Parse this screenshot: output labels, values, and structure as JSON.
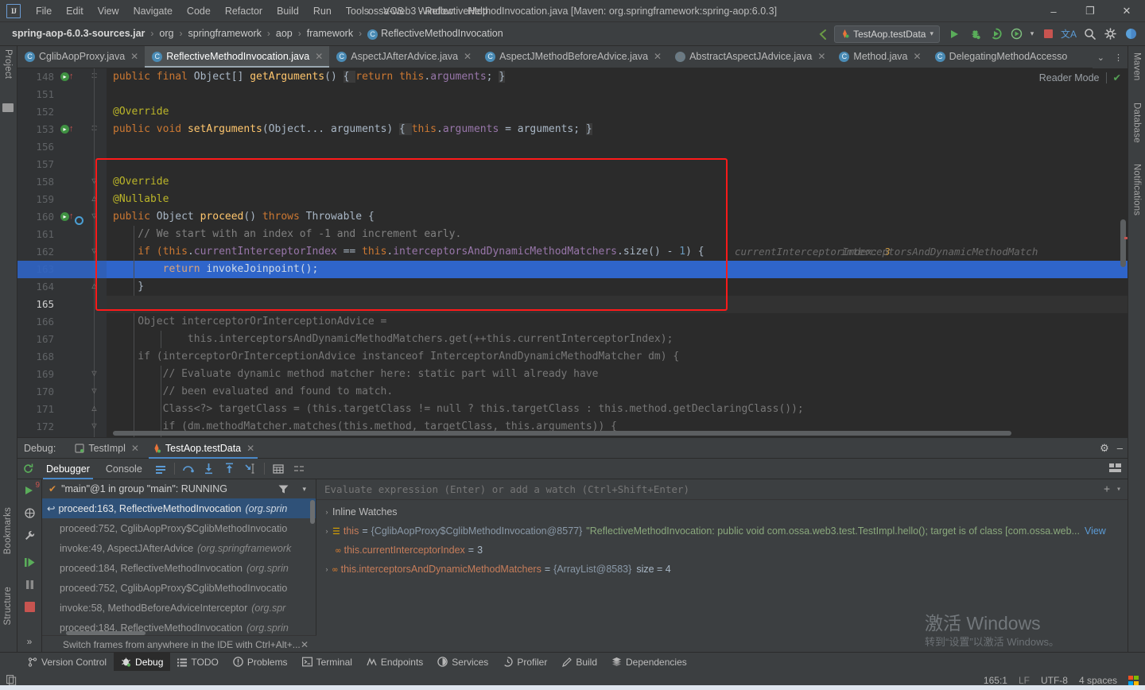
{
  "window": {
    "title": "ossa-web3 - ReflectiveMethodInvocation.java [Maven: org.springframework:spring-aop:6.0.3]",
    "logo": "IJ",
    "minimize": "–",
    "maximize": "❐",
    "close": "✕"
  },
  "menu": {
    "items": [
      "File",
      "Edit",
      "View",
      "Navigate",
      "Code",
      "Refactor",
      "Build",
      "Run",
      "Tools",
      "VCS",
      "Window",
      "Help"
    ]
  },
  "breadcrumbs": {
    "items": [
      {
        "label": "spring-aop-6.0.3-sources.jar",
        "icon": ""
      },
      {
        "label": "org",
        "icon": ""
      },
      {
        "label": "springframework",
        "icon": ""
      },
      {
        "label": "aop",
        "icon": ""
      },
      {
        "label": "framework",
        "icon": ""
      },
      {
        "label": "ReflectiveMethodInvocation",
        "icon": "C"
      }
    ],
    "separator": "›"
  },
  "nav_actions": {
    "back_arrow": "back-arrow-icon",
    "run_config": "TestAop.testData",
    "run_config_chevron": "▾",
    "run": "▶",
    "debug": "debug-icon",
    "coverage": "coverage-icon",
    "profile": "profile-icon",
    "profile_chevron": "▾",
    "stop": "stop-icon",
    "translate": "文A",
    "search": "⌕",
    "settings": "⚙",
    "account": "account-icon"
  },
  "editor_tabs": [
    {
      "label": "CglibAopProxy.java",
      "icon": "C",
      "active": false,
      "closable": true
    },
    {
      "label": "ReflectiveMethodInvocation.java",
      "icon": "C",
      "active": true,
      "closable": true
    },
    {
      "label": "AspectJAfterAdvice.java",
      "icon": "C",
      "active": false,
      "closable": true
    },
    {
      "label": "AspectJMethodBeforeAdvice.java",
      "icon": "C",
      "active": false,
      "closable": true
    },
    {
      "label": "AbstractAspectJAdvice.java",
      "icon": "C",
      "active": false,
      "closable": true,
      "dim": true
    },
    {
      "label": "Method.java",
      "icon": "C",
      "active": false,
      "closable": true
    },
    {
      "label": "DelegatingMethodAccesso",
      "icon": "C",
      "active": false,
      "closable": false
    }
  ],
  "tab_overflow": {
    "chevron": "⌄",
    "more": "⋮"
  },
  "left_strip": {
    "items": [
      {
        "label": "Project"
      }
    ],
    "bottom": [
      {
        "label": "Bookmarks"
      },
      {
        "label": "Structure"
      }
    ]
  },
  "right_strip": {
    "items": [
      {
        "label": "Maven"
      },
      {
        "label": "Database"
      },
      {
        "label": "Notifications"
      }
    ]
  },
  "editor": {
    "reader_mode_label": "Reader Mode",
    "inspection_check": "✔",
    "line_numbers": [
      "148",
      "151",
      "152",
      "153",
      "156",
      "157",
      "158",
      "159",
      "160",
      "161",
      "162",
      "163",
      "164",
      "165",
      "166",
      "167",
      "168",
      "169",
      "170",
      "171",
      "172"
    ],
    "current_line_number": "165",
    "lines": [
      {
        "n": "148",
        "indent": 0,
        "tokens": [
          {
            "t": "public ",
            "c": "kw"
          },
          {
            "t": "final ",
            "c": "kw"
          },
          {
            "t": "Object[] ",
            "c": "typ"
          },
          {
            "t": "getArguments",
            "c": "mth"
          },
          {
            "t": "() ",
            "c": "typ"
          },
          {
            "t": "{ ",
            "c": "brc"
          },
          {
            "t": "return ",
            "c": "kw"
          },
          {
            "t": "this",
            "c": "kw"
          },
          {
            "t": ".",
            "c": "typ"
          },
          {
            "t": "arguments",
            "c": "fld"
          },
          {
            "t": "; ",
            "c": "typ"
          },
          {
            "t": "}",
            "c": "brc"
          }
        ]
      },
      {
        "n": "151",
        "indent": 0,
        "tokens": []
      },
      {
        "n": "152",
        "indent": 0,
        "tokens": [
          {
            "t": "@Override",
            "c": "ann"
          }
        ]
      },
      {
        "n": "153",
        "indent": 0,
        "tokens": [
          {
            "t": "public ",
            "c": "kw"
          },
          {
            "t": "void ",
            "c": "kw"
          },
          {
            "t": "setArguments",
            "c": "mth"
          },
          {
            "t": "(Object... arguments) ",
            "c": "typ"
          },
          {
            "t": "{ ",
            "c": "brc"
          },
          {
            "t": "this",
            "c": "kw"
          },
          {
            "t": ".",
            "c": "typ"
          },
          {
            "t": "arguments",
            "c": "fld"
          },
          {
            "t": " = arguments; ",
            "c": "typ"
          },
          {
            "t": "}",
            "c": "brc"
          }
        ]
      },
      {
        "n": "156",
        "indent": 0,
        "tokens": []
      },
      {
        "n": "157",
        "indent": 0,
        "tokens": []
      },
      {
        "n": "158",
        "indent": 0,
        "tokens": [
          {
            "t": "@Override",
            "c": "ann"
          }
        ]
      },
      {
        "n": "159",
        "indent": 0,
        "tokens": [
          {
            "t": "@Nullable",
            "c": "ann"
          }
        ]
      },
      {
        "n": "160",
        "indent": 0,
        "tokens": [
          {
            "t": "public ",
            "c": "kw"
          },
          {
            "t": "Object ",
            "c": "typ"
          },
          {
            "t": "proceed",
            "c": "mth"
          },
          {
            "t": "() ",
            "c": "typ"
          },
          {
            "t": "throws ",
            "c": "kw"
          },
          {
            "t": "Throwable {",
            "c": "typ"
          }
        ]
      },
      {
        "n": "161",
        "indent": 1,
        "tokens": [
          {
            "t": "// We start with an index of -1 and increment early.",
            "c": "cmt"
          }
        ]
      },
      {
        "n": "162",
        "indent": 1,
        "tokens": [
          {
            "t": "if (",
            "c": "kw"
          },
          {
            "t": "this",
            "c": "kw"
          },
          {
            "t": ".",
            "c": "typ"
          },
          {
            "t": "currentInterceptorIndex",
            "c": "fld"
          },
          {
            "t": " == ",
            "c": "typ"
          },
          {
            "t": "this",
            "c": "kw"
          },
          {
            "t": ".",
            "c": "typ"
          },
          {
            "t": "interceptorsAndDynamicMethodMatchers",
            "c": "fld"
          },
          {
            "t": ".size() - ",
            "c": "typ"
          },
          {
            "t": "1",
            "c": "num"
          },
          {
            "t": ") {",
            "c": "typ"
          }
        ]
      },
      {
        "n": "163",
        "indent": 2,
        "highlight": true,
        "tokens": [
          {
            "t": "return ",
            "c": "kw"
          },
          {
            "t": "invokeJoinpoint",
            "c": "typ"
          },
          {
            "t": "();",
            "c": "typ"
          }
        ]
      },
      {
        "n": "164",
        "indent": 1,
        "tokens": [
          {
            "t": "}",
            "c": "typ"
          }
        ]
      },
      {
        "n": "165",
        "indent": 0,
        "current": true,
        "tokens": []
      },
      {
        "n": "166",
        "indent": 1,
        "tokens": [
          {
            "t": "Object interceptorOrInterceptionAdvice =",
            "c": "dim"
          }
        ]
      },
      {
        "n": "167",
        "indent": 3,
        "tokens": [
          {
            "t": "this.interceptorsAndDynamicMethodMatchers.get(++this.currentInterceptorIndex);",
            "c": "dim"
          }
        ]
      },
      {
        "n": "168",
        "indent": 1,
        "tokens": [
          {
            "t": "if (interceptorOrInterceptionAdvice instanceof InterceptorAndDynamicMethodMatcher dm) {",
            "c": "dim"
          }
        ]
      },
      {
        "n": "169",
        "indent": 2,
        "tokens": [
          {
            "t": "// Evaluate dynamic method matcher here: static part will already have",
            "c": "dim"
          }
        ]
      },
      {
        "n": "170",
        "indent": 2,
        "tokens": [
          {
            "t": "// been evaluated and found to match.",
            "c": "dim"
          }
        ]
      },
      {
        "n": "171",
        "indent": 2,
        "tokens": [
          {
            "t": "Class<?> targetClass = (this.targetClass != null ? this.targetClass : this.method.getDeclaringClass());",
            "c": "dim"
          }
        ]
      },
      {
        "n": "172",
        "indent": 2,
        "tokens": [
          {
            "t": "if (dm.methodMatcher.matches(this.method, targetClass, this.arguments)) {",
            "c": "dim"
          }
        ]
      }
    ],
    "inline_hints": [
      {
        "line": "162",
        "name": "currentInterceptorIndex:",
        "value": "3"
      },
      {
        "line": "162",
        "name": "interceptorsAndDynamicMethodMatch",
        "value": ""
      }
    ],
    "annotation_box": "red-highlight-rectangle"
  },
  "debug": {
    "label": "Debug:",
    "session_tabs": [
      {
        "label": "TestImpl",
        "active": false,
        "closable": true
      },
      {
        "label": "TestAop.testData",
        "active": true,
        "closable": true
      }
    ],
    "header_actions": {
      "settings": "⚙",
      "minimize": "–"
    },
    "toolbar": {
      "rerun": "rerun-icon",
      "tabs": [
        {
          "label": "Debugger",
          "active": true
        },
        {
          "label": "Console",
          "active": false
        }
      ],
      "icons": [
        "frames-icon",
        "step-over-icon",
        "step-into-icon",
        "step-out-icon",
        "run-to-cursor-icon",
        "evaluate-icon",
        "mute-icon"
      ],
      "layout_icon": "layout-icon"
    },
    "side_icons": [
      "resume-icon",
      "threads-icon",
      "settings-wrench-icon",
      "resume-program-icon",
      "pause-icon",
      "stop-icon",
      "expand-icon"
    ],
    "breakpoint_count": "9",
    "thread": {
      "status_icon": "✔",
      "label": "\"main\"@1 in group \"main\": RUNNING",
      "filter": "filter-icon",
      "chevron": "▾"
    },
    "frames": [
      {
        "method": "proceed:163, ReflectiveMethodInvocation",
        "pkg": "(org.sprin",
        "selected": true,
        "marker": "↩"
      },
      {
        "method": "proceed:752, CglibAopProxy$CglibMethodInvocatio",
        "pkg": "",
        "selected": false
      },
      {
        "method": "invoke:49, AspectJAfterAdvice",
        "pkg": "(org.springframework",
        "selected": false
      },
      {
        "method": "proceed:184, ReflectiveMethodInvocation",
        "pkg": "(org.sprin",
        "selected": false
      },
      {
        "method": "proceed:752, CglibAopProxy$CglibMethodInvocatio",
        "pkg": "",
        "selected": false
      },
      {
        "method": "invoke:58, MethodBeforeAdviceInterceptor",
        "pkg": "(org.spr",
        "selected": false
      },
      {
        "method": "proceed:184, ReflectiveMethodInvocation",
        "pkg": "(org.sprin",
        "selected": false
      }
    ],
    "frames_hint": {
      "text": "Switch frames from anywhere in the IDE with Ctrl+Alt+...",
      "close": "✕"
    },
    "evaluate": {
      "placeholder": "Evaluate expression (Enter) or add a watch (Ctrl+Shift+Enter)",
      "add": "+",
      "chevron": "▾"
    },
    "variables": [
      {
        "twisty": "›",
        "icon": "",
        "name": "Inline Watches",
        "eq": "",
        "value": "",
        "indent": 0
      },
      {
        "twisty": "›",
        "icon": "watch-icon",
        "name": "this",
        "eq": "=",
        "value": "{CglibAopProxy$CglibMethodInvocation@8577}",
        "detail": "\"ReflectiveMethodInvocation: public void com.ossa.web3.test.TestImpl.hello(); target is of class [com.ossa.web...",
        "link": "View",
        "indent": 0
      },
      {
        "twisty": "",
        "icon": "oo-icon",
        "name": "this.currentInterceptorIndex",
        "eq": "=",
        "value": "3",
        "indent": 1
      },
      {
        "twisty": "›",
        "icon": "oo-icon",
        "name": "this.interceptorsAndDynamicMethodMatchers",
        "eq": "=",
        "value": "{ArrayList@8583}",
        "detail": "size = 4",
        "indent": 0
      }
    ]
  },
  "bottom_bar": {
    "items": [
      {
        "label": "Version Control",
        "icon": "branch-icon",
        "active": false
      },
      {
        "label": "Debug",
        "icon": "debug-icon",
        "active": true
      },
      {
        "label": "TODO",
        "icon": "todo-icon",
        "active": false
      },
      {
        "label": "Problems",
        "icon": "problems-icon",
        "active": false
      },
      {
        "label": "Terminal",
        "icon": "terminal-icon",
        "active": false
      },
      {
        "label": "Endpoints",
        "icon": "endpoints-icon",
        "active": false
      },
      {
        "label": "Services",
        "icon": "services-icon",
        "active": false
      },
      {
        "label": "Profiler",
        "icon": "profiler-icon",
        "active": false
      },
      {
        "label": "Build",
        "icon": "build-icon",
        "active": false
      },
      {
        "label": "Dependencies",
        "icon": "dependencies-icon",
        "active": false
      }
    ]
  },
  "status_bar": {
    "left_icon": "copy-icon",
    "caret_position": "165:1",
    "line_separator": "LF",
    "encoding": "UTF-8",
    "indent": "4 spaces",
    "os_flag": "windows-flag-icon"
  },
  "watermark": {
    "line1": "激活 Windows",
    "line2": "转到“设置”以激活 Windows。"
  },
  "colors": {
    "accent_blue": "#2f65ca",
    "red_annotation": "#ff1a1a",
    "tab_accent": "#4a88c7",
    "editor_bg": "#2b2b2b",
    "panel_bg": "#3c3f41"
  }
}
